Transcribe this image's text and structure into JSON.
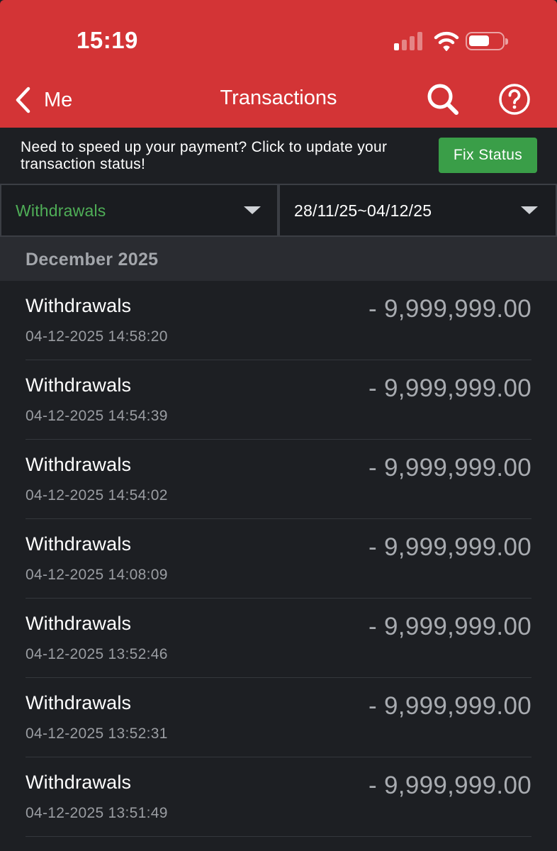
{
  "status_bar": {
    "time": "15:19",
    "signal_bars_filled": 1,
    "signal_bars_total": 4,
    "battery_level": 0.6
  },
  "nav": {
    "back_label": "Me",
    "title": "Transactions",
    "back_icon": "chevron-left-icon",
    "search_icon": "search-icon",
    "help_icon": "help-circle-icon"
  },
  "notice": {
    "text": "Need to speed up your payment? Click to update your transaction status!",
    "button_label": "Fix Status"
  },
  "filters": {
    "type": "Withdrawals",
    "date_range": "28/11/25~04/12/25"
  },
  "section": {
    "title": "December 2025"
  },
  "transactions": [
    {
      "name": "Withdrawals",
      "datetime": "04-12-2025 14:58:20",
      "amount": "- 9,999,999.00"
    },
    {
      "name": "Withdrawals",
      "datetime": "04-12-2025 14:54:39",
      "amount": "- 9,999,999.00"
    },
    {
      "name": "Withdrawals",
      "datetime": "04-12-2025 14:54:02",
      "amount": "- 9,999,999.00"
    },
    {
      "name": "Withdrawals",
      "datetime": "04-12-2025 14:08:09",
      "amount": "- 9,999,999.00"
    },
    {
      "name": "Withdrawals",
      "datetime": "04-12-2025 13:52:46",
      "amount": "- 9,999,999.00"
    },
    {
      "name": "Withdrawals",
      "datetime": "04-12-2025 13:52:31",
      "amount": "- 9,999,999.00"
    },
    {
      "name": "Withdrawals",
      "datetime": "04-12-2025 13:51:49",
      "amount": "- 9,999,999.00"
    }
  ],
  "colors": {
    "header_bg": "#d33436",
    "page_bg": "#1d1f23",
    "accent_green": "#3a9e48",
    "filter_green_text": "#4fae57"
  }
}
